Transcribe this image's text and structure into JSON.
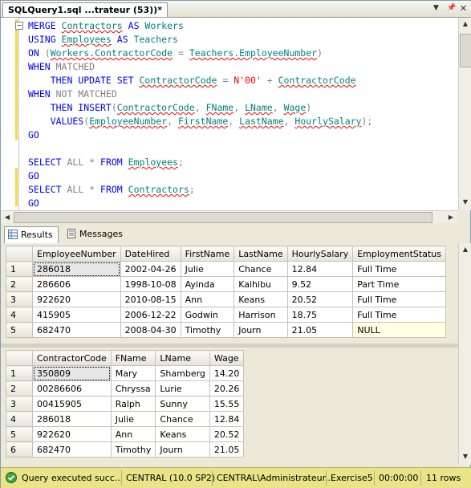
{
  "window": {
    "tab_title": "SQLQuery1.sql ...trateur (53))*"
  },
  "editor": {
    "lines": [
      [
        {
          "t": "MERGE ",
          "c": "kw"
        },
        {
          "t": "Contractors",
          "c": "id"
        },
        {
          "t": " AS ",
          "c": "kw"
        },
        {
          "t": "Workers",
          "c": "pl"
        }
      ],
      [
        {
          "t": "USING ",
          "c": "kw"
        },
        {
          "t": "Employees",
          "c": "id"
        },
        {
          "t": " AS ",
          "c": "kw"
        },
        {
          "t": "Teachers",
          "c": "pl"
        }
      ],
      [
        {
          "t": "ON ",
          "c": "kw"
        },
        {
          "t": "(",
          "c": "gr"
        },
        {
          "t": "Workers.ContractorCode",
          "c": "id"
        },
        {
          "t": " = ",
          "c": "gr"
        },
        {
          "t": "Teachers.EmployeeNumber",
          "c": "id"
        },
        {
          "t": ")",
          "c": "gr"
        }
      ],
      [
        {
          "t": "WHEN ",
          "c": "kw"
        },
        {
          "t": "MATCHED",
          "c": "gr"
        }
      ],
      [
        {
          "t": "    THEN UPDATE SET ",
          "c": "kw"
        },
        {
          "t": "ContractorCode",
          "c": "id"
        },
        {
          "t": " = ",
          "c": "gr"
        },
        {
          "t": "N'00'",
          "c": "str"
        },
        {
          "t": " + ",
          "c": "gr"
        },
        {
          "t": "ContractorCode",
          "c": "id"
        }
      ],
      [
        {
          "t": "WHEN ",
          "c": "kw"
        },
        {
          "t": "NOT MATCHED",
          "c": "gr"
        }
      ],
      [
        {
          "t": "    THEN INSERT",
          "c": "kw"
        },
        {
          "t": "(",
          "c": "gr"
        },
        {
          "t": "ContractorCode",
          "c": "id"
        },
        {
          "t": ", ",
          "c": "gr"
        },
        {
          "t": "FName",
          "c": "id"
        },
        {
          "t": ", ",
          "c": "gr"
        },
        {
          "t": "LName",
          "c": "id"
        },
        {
          "t": ", ",
          "c": "gr"
        },
        {
          "t": "Wage",
          "c": "id"
        },
        {
          "t": ")",
          "c": "gr"
        }
      ],
      [
        {
          "t": "    VALUES",
          "c": "kw"
        },
        {
          "t": "(",
          "c": "gr"
        },
        {
          "t": "EmployeeNumber",
          "c": "id"
        },
        {
          "t": ", ",
          "c": "gr"
        },
        {
          "t": "FirstName",
          "c": "id"
        },
        {
          "t": ", ",
          "c": "gr"
        },
        {
          "t": "LastName",
          "c": "id"
        },
        {
          "t": ", ",
          "c": "gr"
        },
        {
          "t": "HourlySalary",
          "c": "id"
        },
        {
          "t": ");",
          "c": "gr"
        }
      ],
      [
        {
          "t": "GO",
          "c": "kw"
        }
      ],
      [],
      [
        {
          "t": "SELECT ",
          "c": "kw"
        },
        {
          "t": "ALL",
          "c": "gr"
        },
        {
          "t": " * ",
          "c": "gr"
        },
        {
          "t": "FROM ",
          "c": "kw"
        },
        {
          "t": "Employees",
          "c": "id"
        },
        {
          "t": ";",
          "c": "gr"
        }
      ],
      [
        {
          "t": "GO",
          "c": "kw"
        }
      ],
      [
        {
          "t": "SELECT ",
          "c": "kw"
        },
        {
          "t": "ALL",
          "c": "gr"
        },
        {
          "t": " * ",
          "c": "gr"
        },
        {
          "t": "FROM ",
          "c": "kw"
        },
        {
          "t": "Contractors",
          "c": "id"
        },
        {
          "t": ";",
          "c": "gr"
        }
      ],
      [
        {
          "t": "GO",
          "c": "kw"
        }
      ]
    ]
  },
  "results_tabs": {
    "results_label": "Results",
    "messages_label": "Messages"
  },
  "grid1": {
    "columns": [
      "EmployeeNumber",
      "DateHired",
      "FirstName",
      "LastName",
      "HourlySalary",
      "EmploymentStatus"
    ],
    "rows": [
      [
        "1",
        "286018",
        "2002-04-26",
        "Julie",
        "Chance",
        "12.84",
        "Full Time"
      ],
      [
        "2",
        "286606",
        "1998-10-08",
        "Ayinda",
        "Kaihibu",
        "9.52",
        "Part Time"
      ],
      [
        "3",
        "922620",
        "2010-08-15",
        "Ann",
        "Keans",
        "20.52",
        "Full Time"
      ],
      [
        "4",
        "415905",
        "2006-12-22",
        "Godwin",
        "Harrison",
        "18.75",
        "Full Time"
      ],
      [
        "5",
        "682470",
        "2008-04-30",
        "Timothy",
        "Journ",
        "21.05",
        "NULL"
      ]
    ]
  },
  "grid2": {
    "columns": [
      "ContractorCode",
      "FName",
      "LName",
      "Wage"
    ],
    "rows": [
      [
        "1",
        "350809",
        "Mary",
        "Shamberg",
        "14.20"
      ],
      [
        "2",
        "00286606",
        "Chryssa",
        "Lurie",
        "20.26"
      ],
      [
        "3",
        "00415905",
        "Ralph",
        "Sunny",
        "15.55"
      ],
      [
        "4",
        "286018",
        "Julie",
        "Chance",
        "12.84"
      ],
      [
        "5",
        "922620",
        "Ann",
        "Keans",
        "20.52"
      ],
      [
        "6",
        "682470",
        "Timothy",
        "Journ",
        "21.05"
      ]
    ]
  },
  "status": {
    "message": "Query executed succ...",
    "server": "CENTRAL (10.0 SP2)",
    "user": "CENTRAL\\Administrateur...",
    "database": "Exercise5",
    "elapsed": "00:00:00",
    "rows": "11 rows"
  },
  "colors": {
    "keyword": "#0000ff",
    "gray": "#808080",
    "string": "#ff0000",
    "identifier": "#008080",
    "status_bar": "#e9e488"
  }
}
